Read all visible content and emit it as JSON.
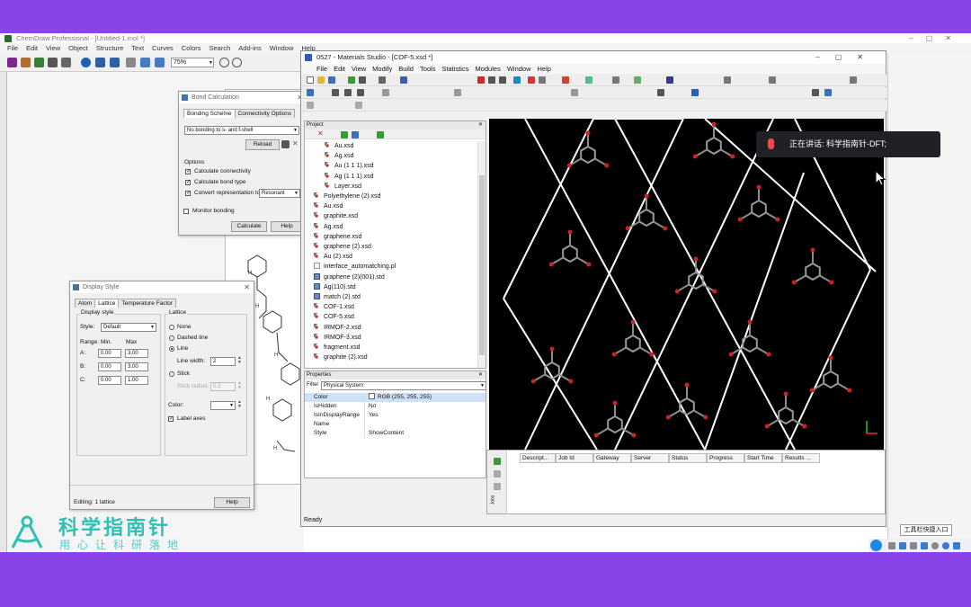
{
  "chemdraw": {
    "title": "ChemDraw Professional - [Untitled-1.mol *]",
    "menu": [
      "File",
      "Edit",
      "View",
      "Object",
      "Structure",
      "Text",
      "Curves",
      "Colors",
      "Search",
      "Add-ins",
      "Window",
      "Help"
    ],
    "zoom": "75%"
  },
  "bond_calc": {
    "title": "Bond Calculation",
    "tabs": [
      "Bonding Scheme",
      "Connectivity Options"
    ],
    "scheme": "No bonding to s- and f-shell",
    "reload": "Reload",
    "options_label": "Options",
    "opt1": "Calculate connectivity",
    "opt2": "Calculate bond type",
    "opt3": "Convert representation to",
    "representation": "Resonant",
    "monitor": "Monitor bonding",
    "calculate": "Calculate",
    "help": "Help"
  },
  "display_style": {
    "title": "Display Style",
    "tabs": [
      "Atom",
      "Lattice",
      "Temperature Factor"
    ],
    "display_style_label": "Display style",
    "style_label": "Style:",
    "style_value": "Default",
    "range_label": "Range:",
    "min_label": "Min.",
    "max_label": "Max",
    "rows": [
      {
        "axis": "A:",
        "min": "0.00",
        "max": "3.00"
      },
      {
        "axis": "B:",
        "min": "0.00",
        "max": "3.00"
      },
      {
        "axis": "C:",
        "min": "0.00",
        "max": "1.00"
      }
    ],
    "lattice_label": "Lattice",
    "none": "None",
    "dashed": "Dashed line",
    "line": "Line",
    "line_width_label": "Line width:",
    "line_width": "2",
    "stick": "Stick",
    "stick_radius_label": "Stick radius:",
    "stick_radius": "0.2",
    "color_label": "Color:",
    "label_axes": "Label axes",
    "editing": "Editing: 1 lattice",
    "help": "Help"
  },
  "ms": {
    "title": "0527 - Materials Studio - [COF-5.xsd *]",
    "menu": [
      "File",
      "Edit",
      "View",
      "Modify",
      "Build",
      "Tools",
      "Statistics",
      "Modules",
      "Window",
      "Help"
    ],
    "project_label": "Project",
    "tree": [
      {
        "name": "Au.xsd",
        "type": "xsd",
        "indent": 1
      },
      {
        "name": "Ag.xsd",
        "type": "xsd",
        "indent": 1
      },
      {
        "name": "Au (1 1 1).xsd",
        "type": "xsd",
        "indent": 1
      },
      {
        "name": "Ag (1 1 1).xsd",
        "type": "xsd",
        "indent": 1
      },
      {
        "name": "Layer.xsd",
        "type": "xsd",
        "indent": 1
      },
      {
        "name": "Polyethylene (2).xsd",
        "type": "xsd",
        "indent": 0
      },
      {
        "name": "Au.xsd",
        "type": "xsd",
        "indent": 0
      },
      {
        "name": "graphite.xsd",
        "type": "xsd",
        "indent": 0
      },
      {
        "name": "Ag.xsd",
        "type": "xsd",
        "indent": 0
      },
      {
        "name": "graphene.xsd",
        "type": "xsd",
        "indent": 0
      },
      {
        "name": "graphene (2).xsd",
        "type": "xsd",
        "indent": 0
      },
      {
        "name": "Au (2).xsd",
        "type": "xsd",
        "indent": 0
      },
      {
        "name": "interface_automatching.pl",
        "type": "pl",
        "indent": 0
      },
      {
        "name": "graphene (2)(001).std",
        "type": "std",
        "indent": 0
      },
      {
        "name": "Ag(110).std",
        "type": "std",
        "indent": 0
      },
      {
        "name": "match (2).std",
        "type": "std",
        "indent": 0
      },
      {
        "name": "COF-1.xsd",
        "type": "xsd",
        "indent": 0
      },
      {
        "name": "COF-5.xsd",
        "type": "xsd",
        "indent": 0
      },
      {
        "name": "IRMOF-2.xsd",
        "type": "xsd",
        "indent": 0
      },
      {
        "name": "IRMOF-3.xsd",
        "type": "xsd",
        "indent": 0
      },
      {
        "name": "fragment.xsd",
        "type": "xsd",
        "indent": 0
      },
      {
        "name": "graphite (2).xsd",
        "type": "xsd",
        "indent": 0
      }
    ],
    "properties_label": "Properties",
    "filter_label": "Filter",
    "filter_value": "Physical System",
    "props": [
      {
        "k": "Color",
        "v": "RGB (255, 255, 255)"
      },
      {
        "k": "IsHidden",
        "v": "No"
      },
      {
        "k": "IsInDisplayRange",
        "v": "Yes"
      },
      {
        "k": "Name",
        "v": ""
      },
      {
        "k": "Style",
        "v": "ShowContent"
      }
    ],
    "job_cols": [
      "Descript...",
      "Job Id",
      "Gateway",
      "Server",
      "Status",
      "Progress",
      "Start Time",
      "Results ..."
    ],
    "jobs_tab": "Jobs",
    "status": "Ready"
  },
  "overlay": {
    "speaking": "正在讲话: 科学指南针-DFT;",
    "brand": "科学指南针",
    "slogan": "用心让科研落地",
    "tray": "工具栏快捷入口"
  },
  "colors": {
    "band": "#8a43e8",
    "brand": "#2fbfb3",
    "lattice": "#ffffff",
    "oxygen": "#cc2222"
  }
}
